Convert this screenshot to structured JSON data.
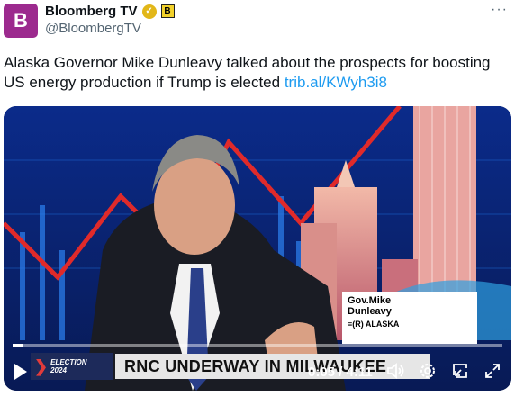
{
  "account": {
    "avatar_letter": "B",
    "display_name": "Bloomberg TV",
    "handle": "@BloombergTV",
    "affiliate_badge": "B",
    "more_label": "···"
  },
  "tweet": {
    "text": "Alaska Governor Mike Dunleavy talked about the prospects for boosting US energy production if Trump is elected ",
    "link": "trib.al/KWyh3i8"
  },
  "video": {
    "namecard_line1": "Gov.Mike",
    "namecard_line2": "Dunleavy",
    "namecard_line3": "≡(R) ALASKA",
    "chyron": "RNC UNDERWAY IN MILWAUKEE",
    "election_badge_line1": "ELECTION",
    "election_badge_line2": "2024",
    "time": "0:05 / 4:11",
    "progress": 0.02
  },
  "icons": {
    "play": "play-icon",
    "volume": "volume-icon",
    "settings": "gear-icon",
    "pip": "picture-in-picture-icon",
    "fullscreen": "fullscreen-icon",
    "verified": "verified-badge-icon"
  },
  "colors": {
    "avatar_bg": "#9c2a8e",
    "link": "#1d9bf0",
    "verified": "#e2b719"
  }
}
